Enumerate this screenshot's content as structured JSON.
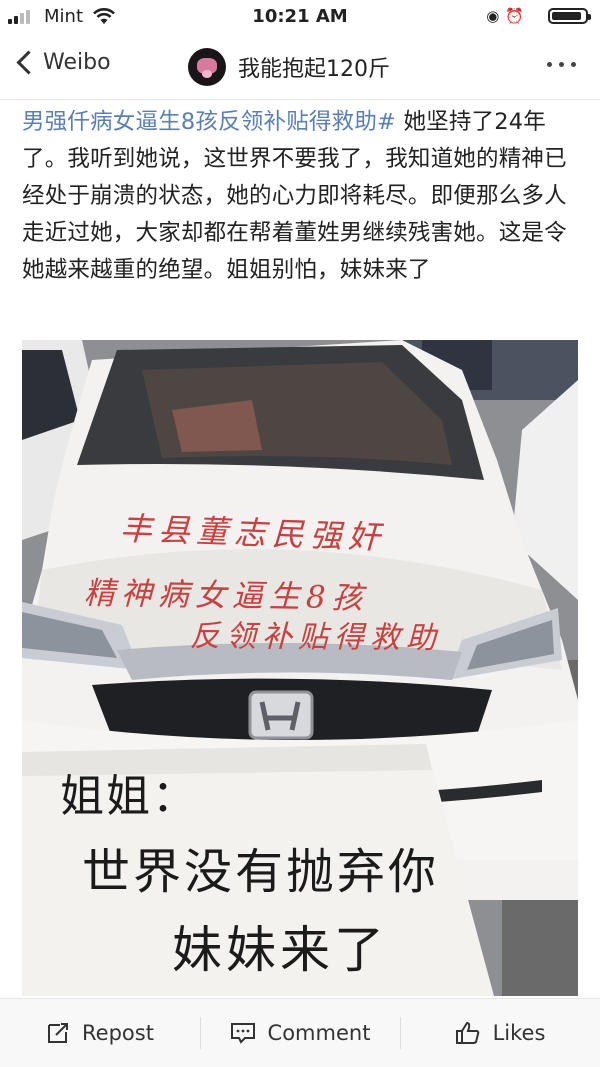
{
  "status_bar": {
    "carrier": "Mint",
    "time": "10:21 AM",
    "battery_level": 0.92
  },
  "nav": {
    "back_label": "Weibo",
    "title": "我能抱起120斤"
  },
  "post": {
    "topic": "男强仟病女逼生8孩反领补贴得救助#",
    "body": "她坚持了24年了。我听到她说，这世界不要我了，我知道她的精神已经处于崩溃的状态，她的心力即将耗尽。即便那么多人走近过她，大家却都在帮着董姓男继续残害她。这是令她越来越重的绝望。姐姐别怕，妹妹来了"
  },
  "photo": {
    "hood_line_1": "丰县董志民强奸",
    "hood_line_2": "精神病女逼生8孩",
    "hood_line_3": "反领补贴得救助",
    "note_line_1": "姐姐：",
    "note_line_2": "世界没有抛弃你",
    "note_line_3": "妹妹来了"
  },
  "actions": {
    "repost": "Repost",
    "comment": "Comment",
    "likes": "Likes"
  },
  "icons": {
    "back": "chevron-left-icon",
    "more": "more-dots-icon",
    "repost": "repost-icon",
    "comment": "comment-icon",
    "likes": "thumbs-up-icon"
  }
}
